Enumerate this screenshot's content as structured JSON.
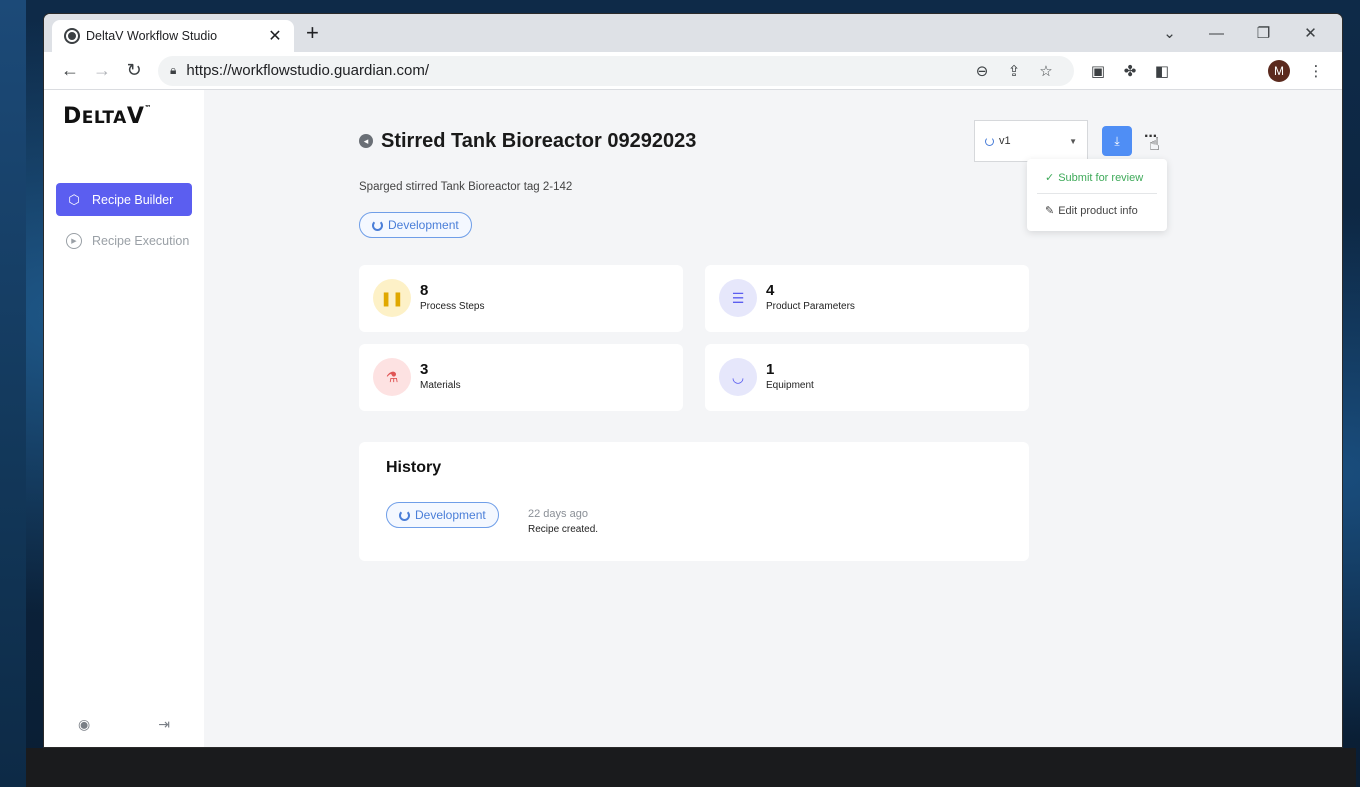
{
  "browser": {
    "tab_title": "DeltaV Workflow Studio",
    "url": "https://workflowstudio.guardian.com/",
    "profile_initial": "M"
  },
  "sidebar": {
    "logo": "DeltaV",
    "items": [
      {
        "label": "Recipe Builder",
        "icon": "cube-icon",
        "active": true
      },
      {
        "label": "Recipe Execution",
        "icon": "play-circle-icon",
        "active": false
      }
    ]
  },
  "recipe": {
    "title": "Stirred Tank Bioreactor 09292023",
    "description": "Sparged stirred Tank Bioreactor tag 2-142",
    "status": "Development",
    "version": "v1"
  },
  "menu": {
    "submit_label": "Submit for review",
    "edit_label": "Edit product info"
  },
  "stats": [
    {
      "count": "8",
      "label": "Process Steps",
      "icon": "footprints-icon",
      "bg": "#fdf1c7",
      "fg": "#e0a800"
    },
    {
      "count": "4",
      "label": "Product Parameters",
      "icon": "sliders-icon",
      "bg": "#e6e7fb",
      "fg": "#5b5ef0"
    },
    {
      "count": "3",
      "label": "Materials",
      "icon": "flask-icon",
      "bg": "#fde2e2",
      "fg": "#e05555"
    },
    {
      "count": "1",
      "label": "Equipment",
      "icon": "mortar-icon",
      "bg": "#e6e7fb",
      "fg": "#5b5ef0"
    }
  ],
  "history": {
    "title": "History",
    "entries": [
      {
        "status": "Development",
        "time": "22 days ago",
        "text": "Recipe created."
      }
    ]
  }
}
